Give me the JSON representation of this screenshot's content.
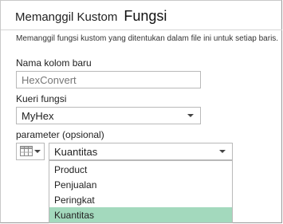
{
  "header": {
    "title_part1": "Memanggil Kustom",
    "title_part2": "Fungsi"
  },
  "description": "Memanggil fungsi kustom yang ditentukan dalam file ini untuk setiap baris.",
  "fields": {
    "column_name": {
      "label": "Nama kolom baru",
      "value": "HexConvert"
    },
    "function_query": {
      "label": "Kueri fungsi",
      "value": "MyHex"
    },
    "parameter": {
      "label": "parameter (opsional)",
      "value": "Kuantitas",
      "type_icon": "table-column-icon"
    }
  },
  "dropdown": {
    "options": [
      "Product",
      "Penjualan",
      "Peringkat",
      "Kuantitas"
    ],
    "selected": "Kuantitas"
  },
  "colors": {
    "selected_option": "#a3d9bd",
    "border": "#b9b9b9"
  }
}
